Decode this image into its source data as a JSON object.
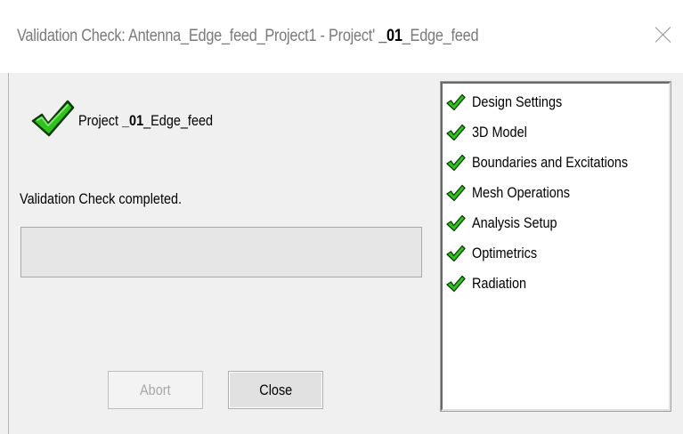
{
  "window": {
    "title_prefix": "Validation Check: Antenna_Edge_feed_Project1 - Project",
    "title_sep": "' ",
    "title_bold": "_01",
    "title_suffix": "_Edge_feed"
  },
  "project": {
    "label_prefix": "Project ",
    "label_bold": "_01",
    "label_suffix": "_Edge_feed",
    "status_icon": "green-check-icon"
  },
  "status": {
    "message": "Validation Check completed.",
    "progress": 0
  },
  "buttons": {
    "abort_label": "Abort",
    "abort_enabled": false,
    "close_label": "Close"
  },
  "checks": [
    {
      "label": "Design Settings",
      "status": "passed"
    },
    {
      "label": "3D Model",
      "status": "passed"
    },
    {
      "label": "Boundaries and Excitations",
      "status": "passed"
    },
    {
      "label": "Mesh Operations",
      "status": "passed"
    },
    {
      "label": "Analysis Setup",
      "status": "passed"
    },
    {
      "label": "Optimetrics",
      "status": "passed"
    },
    {
      "label": "Radiation",
      "status": "passed"
    }
  ],
  "colors": {
    "check_fill": "#2ec21a",
    "check_outline": "#0b3d08",
    "title_text": "#7a7a7a"
  }
}
